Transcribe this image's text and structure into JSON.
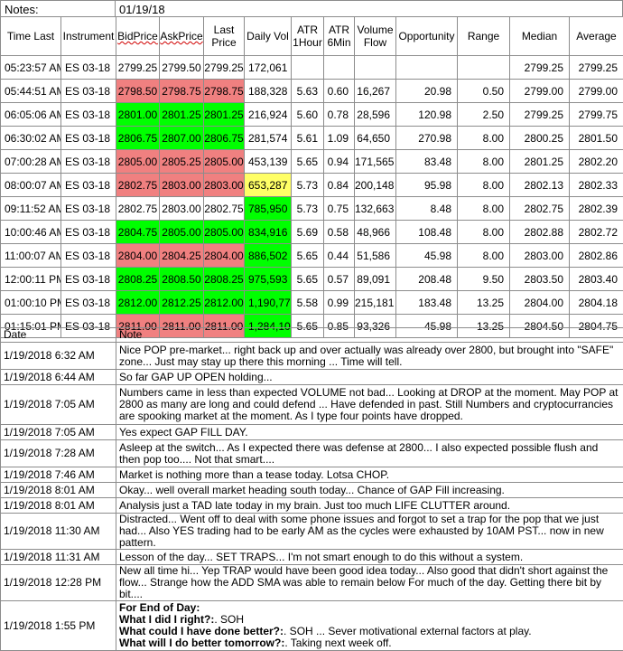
{
  "header": {
    "notes_label": "Notes:",
    "date": "01/19/18"
  },
  "columns": [
    "Time Last",
    "Instrument",
    "BidPrice",
    "AskPrice",
    "Last Price",
    "Daily Vol",
    "ATR 1Hour",
    "ATR 6Min",
    "Volume Flow",
    "Opportunity",
    "Range",
    "Median",
    "Average"
  ],
  "rows": [
    {
      "time": "05:23:57 AM",
      "instrument": "ES 03-18",
      "bid": "2799.25",
      "ask": "2799.50",
      "last": "2799.25",
      "vol": "172,061",
      "atr1h": "",
      "atr6m": "",
      "flow": "",
      "opp": "",
      "range": "",
      "median": "2799.25",
      "avg": "2799.25",
      "bg": "none",
      "volbg": "none"
    },
    {
      "time": "05:44:51 AM",
      "instrument": "ES 03-18",
      "bid": "2798.50",
      "ask": "2798.75",
      "last": "2798.75",
      "vol": "188,328",
      "atr1h": "5.63",
      "atr6m": "0.60",
      "flow": "16,267",
      "opp": "20.98",
      "range": "0.50",
      "median": "2799.00",
      "avg": "2799.00",
      "bg": "red",
      "volbg": "none"
    },
    {
      "time": "06:05:06 AM",
      "instrument": "ES 03-18",
      "bid": "2801.00",
      "ask": "2801.25",
      "last": "2801.25",
      "vol": "216,924",
      "atr1h": "5.60",
      "atr6m": "0.78",
      "flow": "28,596",
      "opp": "120.98",
      "range": "2.50",
      "median": "2799.25",
      "avg": "2799.75",
      "bg": "green",
      "volbg": "none"
    },
    {
      "time": "06:30:02 AM",
      "instrument": "ES 03-18",
      "bid": "2806.75",
      "ask": "2807.00",
      "last": "2806.75",
      "vol": "281,574",
      "atr1h": "5.61",
      "atr6m": "1.09",
      "flow": "64,650",
      "opp": "270.98",
      "range": "8.00",
      "median": "2800.25",
      "avg": "2801.50",
      "bg": "green",
      "volbg": "none"
    },
    {
      "time": "07:00:28 AM",
      "instrument": "ES 03-18",
      "bid": "2805.00",
      "ask": "2805.25",
      "last": "2805.00",
      "vol": "453,139",
      "atr1h": "5.65",
      "atr6m": "0.94",
      "flow": "171,565",
      "opp": "83.48",
      "range": "8.00",
      "median": "2801.25",
      "avg": "2802.20",
      "bg": "red",
      "volbg": "none"
    },
    {
      "time": "08:00:07 AM",
      "instrument": "ES 03-18",
      "bid": "2802.75",
      "ask": "2803.00",
      "last": "2803.00",
      "vol": "653,287",
      "atr1h": "5.73",
      "atr6m": "0.84",
      "flow": "200,148",
      "opp": "95.98",
      "range": "8.00",
      "median": "2802.13",
      "avg": "2802.33",
      "bg": "red",
      "volbg": "yellow"
    },
    {
      "time": "09:11:52 AM",
      "instrument": "ES 03-18",
      "bid": "2802.75",
      "ask": "2803.00",
      "last": "2802.75",
      "vol": "785,950",
      "atr1h": "5.73",
      "atr6m": "0.75",
      "flow": "132,663",
      "opp": "8.48",
      "range": "8.00",
      "median": "2802.75",
      "avg": "2802.39",
      "bg": "none",
      "volbg": "green"
    },
    {
      "time": "10:00:46 AM",
      "instrument": "ES 03-18",
      "bid": "2804.75",
      "ask": "2805.00",
      "last": "2805.00",
      "vol": "834,916",
      "atr1h": "5.69",
      "atr6m": "0.58",
      "flow": "48,966",
      "opp": "108.48",
      "range": "8.00",
      "median": "2802.88",
      "avg": "2802.72",
      "bg": "green",
      "volbg": "green"
    },
    {
      "time": "11:00:07 AM",
      "instrument": "ES 03-18",
      "bid": "2804.00",
      "ask": "2804.25",
      "last": "2804.00",
      "vol": "886,502",
      "atr1h": "5.65",
      "atr6m": "0.44",
      "flow": "51,586",
      "opp": "45.98",
      "range": "8.00",
      "median": "2803.00",
      "avg": "2802.86",
      "bg": "red",
      "volbg": "green"
    },
    {
      "time": "12:00:11 PM",
      "instrument": "ES 03-18",
      "bid": "2808.25",
      "ask": "2808.50",
      "last": "2808.25",
      "vol": "975,593",
      "atr1h": "5.65",
      "atr6m": "0.57",
      "flow": "89,091",
      "opp": "208.48",
      "range": "9.50",
      "median": "2803.50",
      "avg": "2803.40",
      "bg": "green",
      "volbg": "green"
    },
    {
      "time": "01:00:10 PM",
      "instrument": "ES 03-18",
      "bid": "2812.00",
      "ask": "2812.25",
      "last": "2812.00",
      "vol": "1,190,774",
      "atr1h": "5.58",
      "atr6m": "0.99",
      "flow": "215,181",
      "opp": "183.48",
      "range": "13.25",
      "median": "2804.00",
      "avg": "2804.18",
      "bg": "green",
      "volbg": "green"
    },
    {
      "time": "01:15:01 PM",
      "instrument": "ES 03-18",
      "bid": "2811.00",
      "ask": "2811.00",
      "last": "2811.00",
      "vol": "1,284,100",
      "atr1h": "5.65",
      "atr6m": "0.85",
      "flow": "93,326",
      "opp": "45.98",
      "range": "13.25",
      "median": "2804.50",
      "avg": "2804.75",
      "bg": "red",
      "volbg": "green"
    }
  ],
  "notes_header": {
    "date": "Date",
    "note": "Note"
  },
  "notes": [
    {
      "date": "1/19/2018 6:32 AM",
      "text": "Nice POP pre-market... right back up and over actually was already over 2800, but brought into \"SAFE\" zone... Just may stay up there this morning ... Time will tell."
    },
    {
      "date": "1/19/2018 6:44 AM",
      "text": "So far GAP UP OPEN holding..."
    },
    {
      "date": "1/19/2018 7:05 AM",
      "text": "Numbers came in less than expected VOLUME not bad... Looking at DROP at the moment.  May POP at 2800 as many are long and could defend ... Have defended in past.  Still Numbers and cryptocurrancies are spooking market at the moment.  As I type four points have dropped."
    },
    {
      "date": "1/19/2018 7:05 AM",
      "text": "Yes expect GAP FILL DAY."
    },
    {
      "date": "1/19/2018 7:28 AM",
      "text": "Asleep at the switch... As I expected there was defense at 2800... I also expected possible flush and then pop too.... Not that smart...."
    },
    {
      "date": "1/19/2018 7:46 AM",
      "text": "Market is nothing more than a tease today.  Lotsa CHOP."
    },
    {
      "date": "1/19/2018 8:01 AM",
      "text": "Okay... well overall market heading south today... Chance of GAP Fill increasing."
    },
    {
      "date": "1/19/2018 8:01 AM",
      "text": "Analysis just a TAD late today in my brain.  Just too much LIFE CLUTTER around."
    },
    {
      "date": "1/19/2018 11:30 AM",
      "text": "Distracted... Went off to deal with some phone issues and forgot to set a trap for the pop that we just had... Also YES trading had to be early AM as the cycles were exhausted by 10AM PST... now in new pattern."
    },
    {
      "date": "1/19/2018 11:31 AM",
      "text": "Lesson of the day... SET TRAPS... I'm not smart enough to do this without a system."
    },
    {
      "date": "1/19/2018 12:28 PM",
      "text": "New all time hi... Yep TRAP would have been good idea today... Also good that didn't short against the flow... Strange how the ADD SMA was able to remain below For much of the day.  Getting there bit by bit...."
    },
    {
      "date": "1/19/2018 1:55 PM",
      "eod": {
        "l1": "For End of Day:",
        "l2b": "What I did I right?:",
        "l2": ".  SOH",
        "l3b": "What could I have done better?:",
        "l3": ". SOH ... Sever motivational external factors at play.",
        "l4b": "What will I do better tomorrow?:",
        "l4": ". Taking next week off."
      }
    }
  ]
}
